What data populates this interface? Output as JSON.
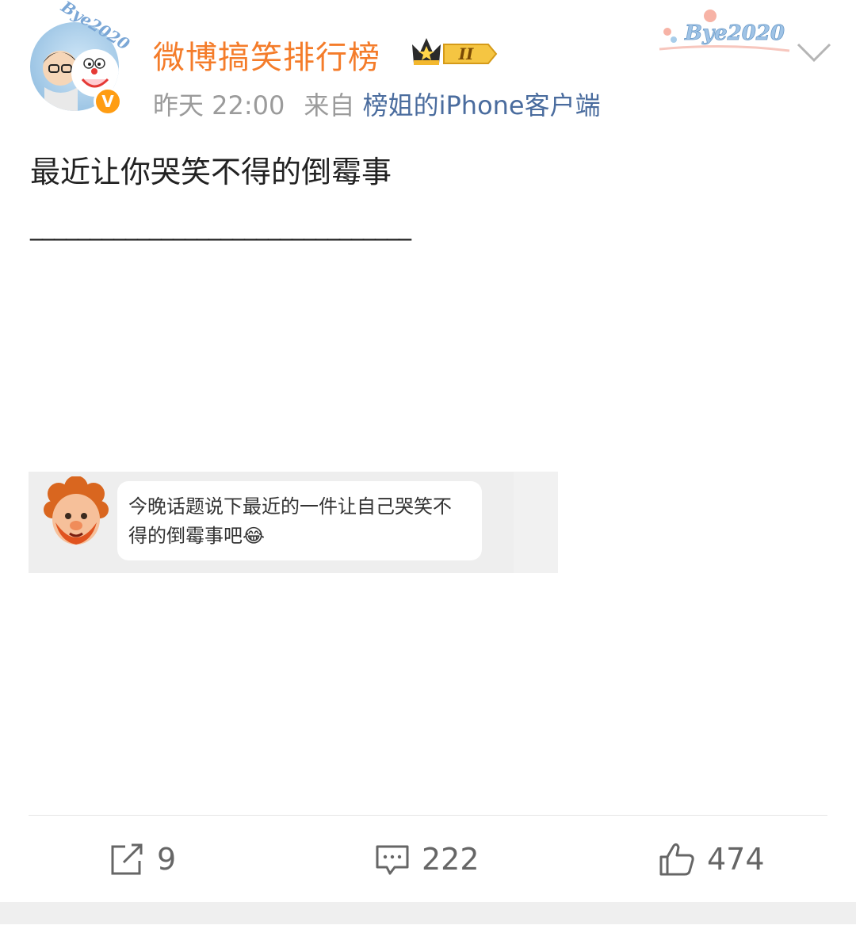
{
  "header": {
    "username": "微博搞笑排行榜",
    "member_level": "II",
    "verified_mark": "V",
    "avatar_frame_text": "Bye2020",
    "card_frame_text": "Bye2020",
    "time": "昨天 22:00",
    "source_prefix": "来自",
    "source": "榜姐的iPhone客户端"
  },
  "post": {
    "text": "最近让你哭笑不得的倒霉事",
    "underline": "________________________________",
    "image": {
      "bubble_text": "今晚话题说下最近的一件让自己哭笑不得的倒霉事吧😂"
    }
  },
  "actions": {
    "repost_count": "9",
    "comment_count": "222",
    "like_count": "474"
  },
  "colors": {
    "username": "#f47c2a",
    "source_link": "#4a6c9e",
    "meta_gray": "#9b9b9b",
    "badge_orange": "#ff9d13"
  },
  "icons": [
    "chevron-down-icon",
    "repost-icon",
    "comment-icon",
    "like-icon",
    "crown-icon"
  ]
}
